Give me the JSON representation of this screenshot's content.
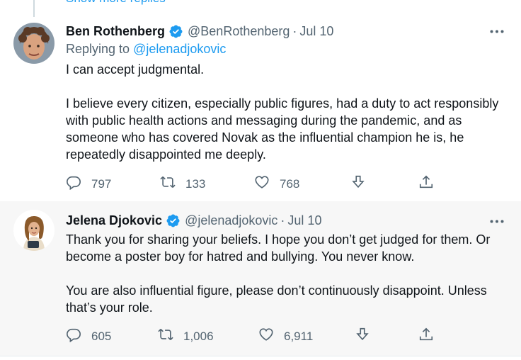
{
  "thread": {
    "show_more_replies": "Show more replies"
  },
  "tweets": [
    {
      "author": "Ben Rothenberg",
      "handle": "@BenRothenberg",
      "separator": "·",
      "date": "Jul 10",
      "replying_label": "Replying to",
      "replying_to": "@jelenadjokovic",
      "paragraphs": [
        "I can accept judgmental.",
        "I believe every citizen, especially public figures, had a duty to act responsibly with public health actions and messaging during the pandemic, and as someone who has covered Novak as the influential champion he is, he repeatedly disappointed me deeply."
      ],
      "replies": "797",
      "retweets": "133",
      "likes": "768"
    },
    {
      "author": "Jelena Djokovic",
      "handle": "@jelenadjokovic",
      "separator": "·",
      "date": "Jul 10",
      "paragraphs": [
        "Thank you for sharing your beliefs. I hope you don’t get judged for them. Or become a poster boy for hatred and bullying. You never know.",
        "You are also influential figure, please don’t continuously disappoint. Unless that’s your role."
      ],
      "replies": "605",
      "retweets": "1,006",
      "likes": "6,911"
    }
  ],
  "icons": {
    "verified": "verified-badge-icon",
    "more": "more-horizontal-icon",
    "reply": "reply-icon",
    "retweet": "retweet-icon",
    "like": "like-heart-icon",
    "download": "download-icon",
    "share": "share-icon"
  },
  "colors": {
    "link": "#1d9bf0",
    "secondary_text": "#536471",
    "thread_line": "#cfd9de",
    "highlight_bg": "#f7f7f7"
  }
}
